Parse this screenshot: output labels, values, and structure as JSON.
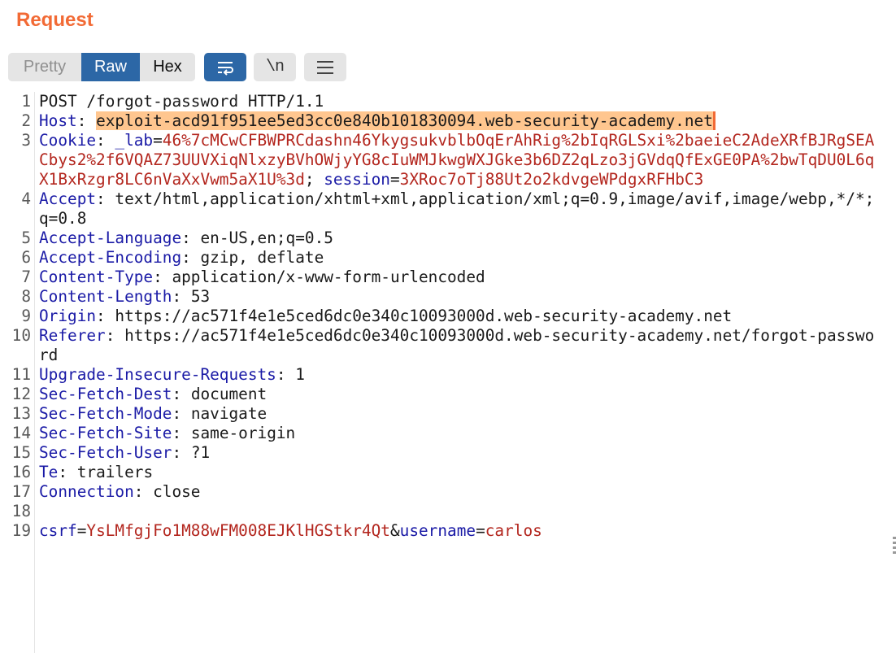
{
  "panel": {
    "title": "Request"
  },
  "toolbar": {
    "pretty": "Pretty",
    "raw": "Raw",
    "hex": "Hex",
    "newline_glyph": "\\n",
    "active_tab": "Raw",
    "accent": "#2c67a6"
  },
  "request": {
    "request_line": "POST /forgot-password HTTP/1.1",
    "host": {
      "name": "Host",
      "value": "exploit-acd91f951ee5ed3cc0e840b101830094.web-security-academy.net"
    },
    "cookie": {
      "name": "Cookie",
      "lab_name": "_lab",
      "lab_value": "46%7cMCwCFBWPRCdashn46YkygsukvblbOqErAhRig%2bIqRGLSxi%2baeieC2AdeXRfBJRgSEACbys2%2f6VQAZ73UUVXiqNlxzyBVhOWjyYG8cIuWMJkwgWXJGke3b6DZ2qLzo3jGVdqQfExGE0PA%2bwTqDU0L6qX1BxRzgr8LC6nVaXxVwm5aX1U%3d",
      "session_name": "session",
      "session_value": "3XRoc7oTj88Ut2o2kdvgeWPdgxRFHbC3"
    },
    "accept": {
      "name": "Accept",
      "value": "text/html,application/xhtml+xml,application/xml;q=0.9,image/avif,image/webp,*/*;q=0.8"
    },
    "accept_language": {
      "name": "Accept-Language",
      "value": "en-US,en;q=0.5"
    },
    "accept_encoding": {
      "name": "Accept-Encoding",
      "value": "gzip, deflate"
    },
    "content_type": {
      "name": "Content-Type",
      "value": "application/x-www-form-urlencoded"
    },
    "content_length": {
      "name": "Content-Length",
      "value": "53"
    },
    "origin": {
      "name": "Origin",
      "value": "https://ac571f4e1e5ced6dc0e340c10093000d.web-security-academy.net"
    },
    "referer": {
      "name": "Referer",
      "value": "https://ac571f4e1e5ced6dc0e340c10093000d.web-security-academy.net/forgot-password"
    },
    "upgrade_insecure_requests": {
      "name": "Upgrade-Insecure-Requests",
      "value": "1"
    },
    "sec_fetch_dest": {
      "name": "Sec-Fetch-Dest",
      "value": "document"
    },
    "sec_fetch_mode": {
      "name": "Sec-Fetch-Mode",
      "value": "navigate"
    },
    "sec_fetch_site": {
      "name": "Sec-Fetch-Site",
      "value": "same-origin"
    },
    "sec_fetch_user": {
      "name": "Sec-Fetch-User",
      "value": "?1"
    },
    "te": {
      "name": "Te",
      "value": "trailers"
    },
    "connection": {
      "name": "Connection",
      "value": "close"
    },
    "body": {
      "csrf_name": "csrf",
      "csrf_value": "YsLMfgjFo1M88wFM008EJKlHGStkr4Qt",
      "username_name": "username",
      "username_value": "carlos"
    }
  },
  "line_numbers": [
    "1",
    "2",
    "3",
    "4",
    "5",
    "6",
    "7",
    "8",
    "9",
    "10",
    "11",
    "12",
    "13",
    "14",
    "15",
    "16",
    "17",
    "18",
    "19"
  ],
  "colors": {
    "title": "#f26a35",
    "header_name": "#1a1aa6",
    "param_value": "#b3261e",
    "highlight": "#ffc68f"
  }
}
